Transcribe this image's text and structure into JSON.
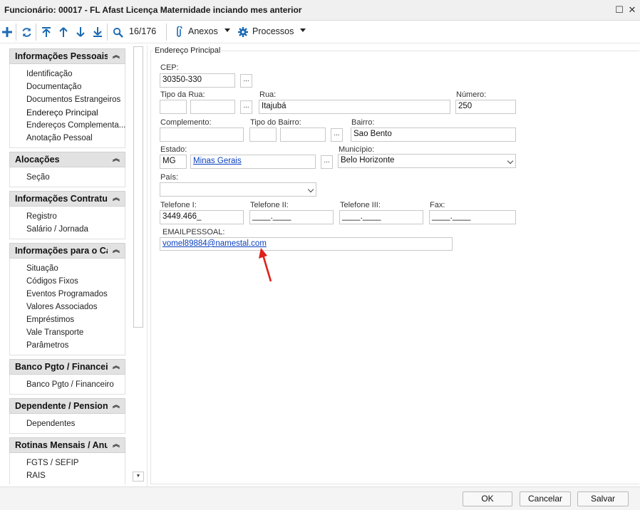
{
  "window": {
    "title": "Funcionário: 00017 - FL Afast Licença Maternidade inciando mes anterior",
    "maximize_icon": "square-icon",
    "close_icon": "x-icon"
  },
  "toolbar": {
    "record_counter": "16/176",
    "anexos_label": "Anexos",
    "processos_label": "Processos"
  },
  "sidebar": {
    "sections": [
      {
        "title": "Informações Pessoais",
        "items": [
          "Identificação",
          "Documentação",
          "Documentos Estrangeiros",
          "Endereço Principal",
          "Endereços Complementa...",
          "Anotação Pessoal"
        ],
        "active": "Endereço Principal"
      },
      {
        "title": "Alocações",
        "items": [
          "Seção"
        ]
      },
      {
        "title": "Informações Contratuai",
        "items": [
          "Registro",
          "Salário / Jornada"
        ]
      },
      {
        "title": "Informações para o Cál",
        "items": [
          "Situação",
          "Códigos Fixos",
          "Eventos Programados",
          "Valores Associados",
          "Empréstimos",
          "Vale Transporte",
          "Parâmetros"
        ]
      },
      {
        "title": "Banco Pgto / Financeir",
        "items": [
          "Banco Pgto / Financeiro"
        ]
      },
      {
        "title": "Dependente / Pensioni",
        "items": [
          "Dependentes"
        ]
      },
      {
        "title": "Rotinas Mensais / Anu",
        "items": [
          "FGTS / SEFIP",
          "RAIS"
        ]
      }
    ]
  },
  "form": {
    "group_title": "Endereço Principal",
    "cep_label": "CEP:",
    "cep_value": "30350-330",
    "tipo_rua_label": "Tipo da Rua:",
    "tipo_rua_code": "",
    "tipo_rua_desc": "",
    "rua_label": "Rua:",
    "rua_value": "Itajubá",
    "numero_label": "Número:",
    "numero_value": "250",
    "complemento_label": "Complemento:",
    "complemento_value": "",
    "tipo_bairro_label": "Tipo do Bairro:",
    "tipo_bairro_code": "",
    "tipo_bairro_desc": "",
    "bairro_label": "Bairro:",
    "bairro_value": "Sao Bento",
    "estado_label": "Estado:",
    "estado_code": "MG",
    "estado_name": "Minas Gerais",
    "municipio_label": "Município:",
    "municipio_value": "Belo Horizonte",
    "pais_label": "País:",
    "pais_value": "",
    "tel1_label": "Telefone I:",
    "tel1_value": "3449.466_",
    "tel2_label": "Telefone II:",
    "tel2_value": "____.____",
    "tel3_label": "Telefone III:",
    "tel3_value": "____.____",
    "fax_label": "Fax:",
    "fax_value": "____.____",
    "email_label": "EMAILPESSOAL:",
    "email_value": "vomel89884@namestal.com",
    "lookup_button": "..."
  },
  "buttons": {
    "ok": "OK",
    "cancel": "Cancelar",
    "save": "Salvar"
  },
  "colors": {
    "accent": "#1a6ab3",
    "link": "#0a3fbf",
    "annotation_arrow": "#e0201b"
  }
}
